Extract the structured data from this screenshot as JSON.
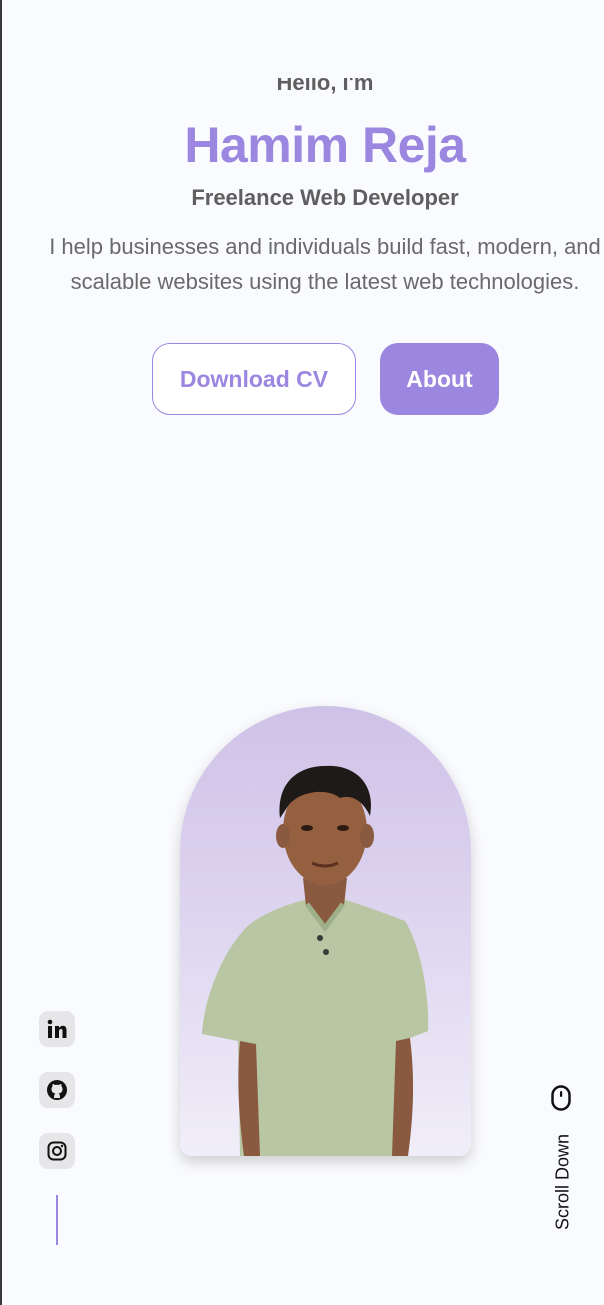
{
  "hero": {
    "greeting": "Hello, I'm",
    "name": "Hamim Reja",
    "role": "Freelance Web Developer",
    "description": "I help businesses and individuals build fast, modern, and scalable websites using the latest web technologies."
  },
  "buttons": {
    "download_cv": "Download CV",
    "about": "About"
  },
  "social": {
    "items": [
      "linkedin-icon",
      "github-icon",
      "instagram-icon"
    ]
  },
  "scroll": {
    "label": "Scroll Down",
    "icon": "mouse-icon"
  },
  "colors": {
    "accent": "#9b87e0",
    "text": "#5f5f5f",
    "background": "#fafbfe"
  }
}
